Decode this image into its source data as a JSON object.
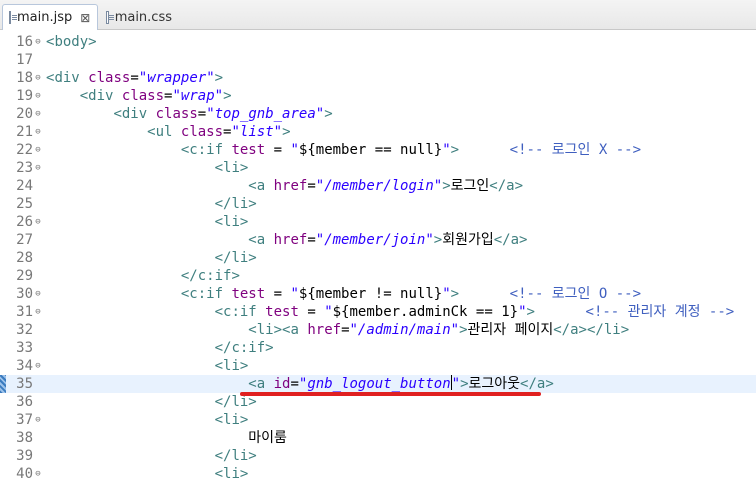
{
  "tabs": [
    {
      "label": "main.jsp",
      "active": true,
      "close_glyph": "⊠"
    },
    {
      "label": "main.css",
      "active": false
    }
  ],
  "fold_glyph": "⊖",
  "lines": [
    {
      "num": "16",
      "fold": true,
      "indent": "",
      "tokens": [
        [
          "tag",
          "<"
        ],
        [
          "tag",
          "body"
        ],
        [
          "tag",
          ">"
        ]
      ]
    },
    {
      "num": "17",
      "fold": false,
      "indent": "",
      "tokens": []
    },
    {
      "num": "18",
      "fold": true,
      "indent": "",
      "tokens": [
        [
          "tag",
          "<"
        ],
        [
          "tag",
          "div"
        ],
        [
          "txt",
          " "
        ],
        [
          "attr",
          "class"
        ],
        [
          "txt",
          "="
        ],
        [
          "val",
          "\"wrapper\""
        ],
        [
          "tag",
          ">"
        ]
      ]
    },
    {
      "num": "19",
      "fold": true,
      "indent": "    ",
      "tokens": [
        [
          "tag",
          "<"
        ],
        [
          "tag",
          "div"
        ],
        [
          "txt",
          " "
        ],
        [
          "attr",
          "class"
        ],
        [
          "txt",
          "="
        ],
        [
          "val",
          "\"wrap\""
        ],
        [
          "tag",
          ">"
        ]
      ]
    },
    {
      "num": "20",
      "fold": true,
      "indent": "        ",
      "tokens": [
        [
          "tag",
          "<"
        ],
        [
          "tag",
          "div"
        ],
        [
          "txt",
          " "
        ],
        [
          "attr",
          "class"
        ],
        [
          "txt",
          "="
        ],
        [
          "val",
          "\"top_gnb_area\""
        ],
        [
          "tag",
          ">"
        ]
      ]
    },
    {
      "num": "21",
      "fold": true,
      "indent": "            ",
      "tokens": [
        [
          "tag",
          "<"
        ],
        [
          "tag",
          "ul"
        ],
        [
          "txt",
          " "
        ],
        [
          "attr",
          "class"
        ],
        [
          "txt",
          "="
        ],
        [
          "val",
          "\"list\""
        ],
        [
          "tag",
          ">"
        ]
      ]
    },
    {
      "num": "22",
      "fold": true,
      "indent": "                ",
      "tokens": [
        [
          "tag",
          "<"
        ],
        [
          "tag",
          "c:if"
        ],
        [
          "txt",
          " "
        ],
        [
          "attr",
          "test"
        ],
        [
          "txt",
          " = "
        ],
        [
          "val",
          "\""
        ],
        [
          "txt",
          "${member == null}"
        ],
        [
          "val",
          "\""
        ],
        [
          "tag",
          ">"
        ],
        [
          "txt",
          "      "
        ],
        [
          "cmt",
          "<!-- 로그인 X -->"
        ]
      ]
    },
    {
      "num": "23",
      "fold": true,
      "indent": "                    ",
      "tokens": [
        [
          "tag",
          "<"
        ],
        [
          "tag",
          "li"
        ],
        [
          "tag",
          ">"
        ]
      ]
    },
    {
      "num": "24",
      "fold": false,
      "indent": "                        ",
      "tokens": [
        [
          "tag",
          "<"
        ],
        [
          "tag",
          "a"
        ],
        [
          "txt",
          " "
        ],
        [
          "attr",
          "href"
        ],
        [
          "txt",
          "="
        ],
        [
          "val",
          "\"/member/login\""
        ],
        [
          "tag",
          ">"
        ],
        [
          "txt",
          "로그인"
        ],
        [
          "tag",
          "</"
        ],
        [
          "tag",
          "a"
        ],
        [
          "tag",
          ">"
        ]
      ]
    },
    {
      "num": "25",
      "fold": false,
      "indent": "                    ",
      "tokens": [
        [
          "tag",
          "</"
        ],
        [
          "tag",
          "li"
        ],
        [
          "tag",
          ">"
        ]
      ]
    },
    {
      "num": "26",
      "fold": true,
      "indent": "                    ",
      "tokens": [
        [
          "tag",
          "<"
        ],
        [
          "tag",
          "li"
        ],
        [
          "tag",
          ">"
        ]
      ]
    },
    {
      "num": "27",
      "fold": false,
      "indent": "                        ",
      "tokens": [
        [
          "tag",
          "<"
        ],
        [
          "tag",
          "a"
        ],
        [
          "txt",
          " "
        ],
        [
          "attr",
          "href"
        ],
        [
          "txt",
          "="
        ],
        [
          "val",
          "\"/member/join\""
        ],
        [
          "tag",
          ">"
        ],
        [
          "txt",
          "회원가입"
        ],
        [
          "tag",
          "</"
        ],
        [
          "tag",
          "a"
        ],
        [
          "tag",
          ">"
        ]
      ]
    },
    {
      "num": "28",
      "fold": false,
      "indent": "                    ",
      "tokens": [
        [
          "tag",
          "</"
        ],
        [
          "tag",
          "li"
        ],
        [
          "tag",
          ">"
        ]
      ]
    },
    {
      "num": "29",
      "fold": false,
      "indent": "                ",
      "tokens": [
        [
          "tag",
          "</"
        ],
        [
          "tag",
          "c:if"
        ],
        [
          "tag",
          ">"
        ]
      ]
    },
    {
      "num": "30",
      "fold": true,
      "indent": "                ",
      "tokens": [
        [
          "tag",
          "<"
        ],
        [
          "tag",
          "c:if"
        ],
        [
          "txt",
          " "
        ],
        [
          "attr",
          "test"
        ],
        [
          "txt",
          " = "
        ],
        [
          "val",
          "\""
        ],
        [
          "txt",
          "${member != null}"
        ],
        [
          "val",
          "\""
        ],
        [
          "tag",
          ">"
        ],
        [
          "txt",
          "      "
        ],
        [
          "cmt",
          "<!-- 로그인 O -->"
        ]
      ]
    },
    {
      "num": "31",
      "fold": true,
      "indent": "                    ",
      "tokens": [
        [
          "tag",
          "<"
        ],
        [
          "tag",
          "c:if"
        ],
        [
          "txt",
          " "
        ],
        [
          "attr",
          "test"
        ],
        [
          "txt",
          " = "
        ],
        [
          "val",
          "\""
        ],
        [
          "txt",
          "${member.adminCk == 1}"
        ],
        [
          "val",
          "\""
        ],
        [
          "tag",
          ">"
        ],
        [
          "txt",
          "      "
        ],
        [
          "cmt",
          "<!-- 관리자 계정 -->"
        ]
      ]
    },
    {
      "num": "32",
      "fold": false,
      "indent": "                        ",
      "tokens": [
        [
          "tag",
          "<"
        ],
        [
          "tag",
          "li"
        ],
        [
          "tag",
          ">"
        ],
        [
          "tag",
          "<"
        ],
        [
          "tag",
          "a"
        ],
        [
          "txt",
          " "
        ],
        [
          "attr",
          "href"
        ],
        [
          "txt",
          "="
        ],
        [
          "val",
          "\"/admin/main\""
        ],
        [
          "tag",
          ">"
        ],
        [
          "txt",
          "관리자 페이지"
        ],
        [
          "tag",
          "</"
        ],
        [
          "tag",
          "a"
        ],
        [
          "tag",
          ">"
        ],
        [
          "tag",
          "</"
        ],
        [
          "tag",
          "li"
        ],
        [
          "tag",
          ">"
        ]
      ]
    },
    {
      "num": "33",
      "fold": false,
      "indent": "                    ",
      "tokens": [
        [
          "tag",
          "</"
        ],
        [
          "tag",
          "c:if"
        ],
        [
          "tag",
          ">"
        ]
      ]
    },
    {
      "num": "34",
      "fold": true,
      "indent": "                    ",
      "tokens": [
        [
          "tag",
          "<"
        ],
        [
          "tag",
          "li"
        ],
        [
          "tag",
          ">"
        ]
      ]
    },
    {
      "num": "35",
      "fold": false,
      "indent": "                        ",
      "current": true,
      "tokens": [
        [
          "tag",
          "<"
        ],
        [
          "tag",
          "a"
        ],
        [
          "txt",
          " "
        ],
        [
          "attr",
          "id"
        ],
        [
          "txt",
          "="
        ],
        [
          "val",
          "\"gnb_logout_button"
        ],
        [
          "caret",
          ""
        ],
        [
          "val",
          "\""
        ],
        [
          "tag",
          ">"
        ],
        [
          "txt",
          "로그아웃"
        ],
        [
          "tag",
          "</"
        ],
        [
          "tag",
          "a"
        ],
        [
          "tag",
          ">"
        ]
      ]
    },
    {
      "num": "36",
      "fold": false,
      "indent": "                    ",
      "tokens": [
        [
          "tag",
          "</"
        ],
        [
          "tag",
          "li"
        ],
        [
          "tag",
          ">"
        ]
      ]
    },
    {
      "num": "37",
      "fold": true,
      "indent": "                    ",
      "tokens": [
        [
          "tag",
          "<"
        ],
        [
          "tag",
          "li"
        ],
        [
          "tag",
          ">"
        ]
      ]
    },
    {
      "num": "38",
      "fold": false,
      "indent": "                        ",
      "tokens": [
        [
          "txt",
          "마이룸"
        ]
      ]
    },
    {
      "num": "39",
      "fold": false,
      "indent": "                    ",
      "tokens": [
        [
          "tag",
          "</"
        ],
        [
          "tag",
          "li"
        ],
        [
          "tag",
          ">"
        ]
      ]
    },
    {
      "num": "40",
      "fold": true,
      "indent": "                    ",
      "tokens": [
        [
          "tag",
          "<"
        ],
        [
          "tag",
          "li"
        ],
        [
          "tag",
          ">"
        ]
      ]
    }
  ]
}
